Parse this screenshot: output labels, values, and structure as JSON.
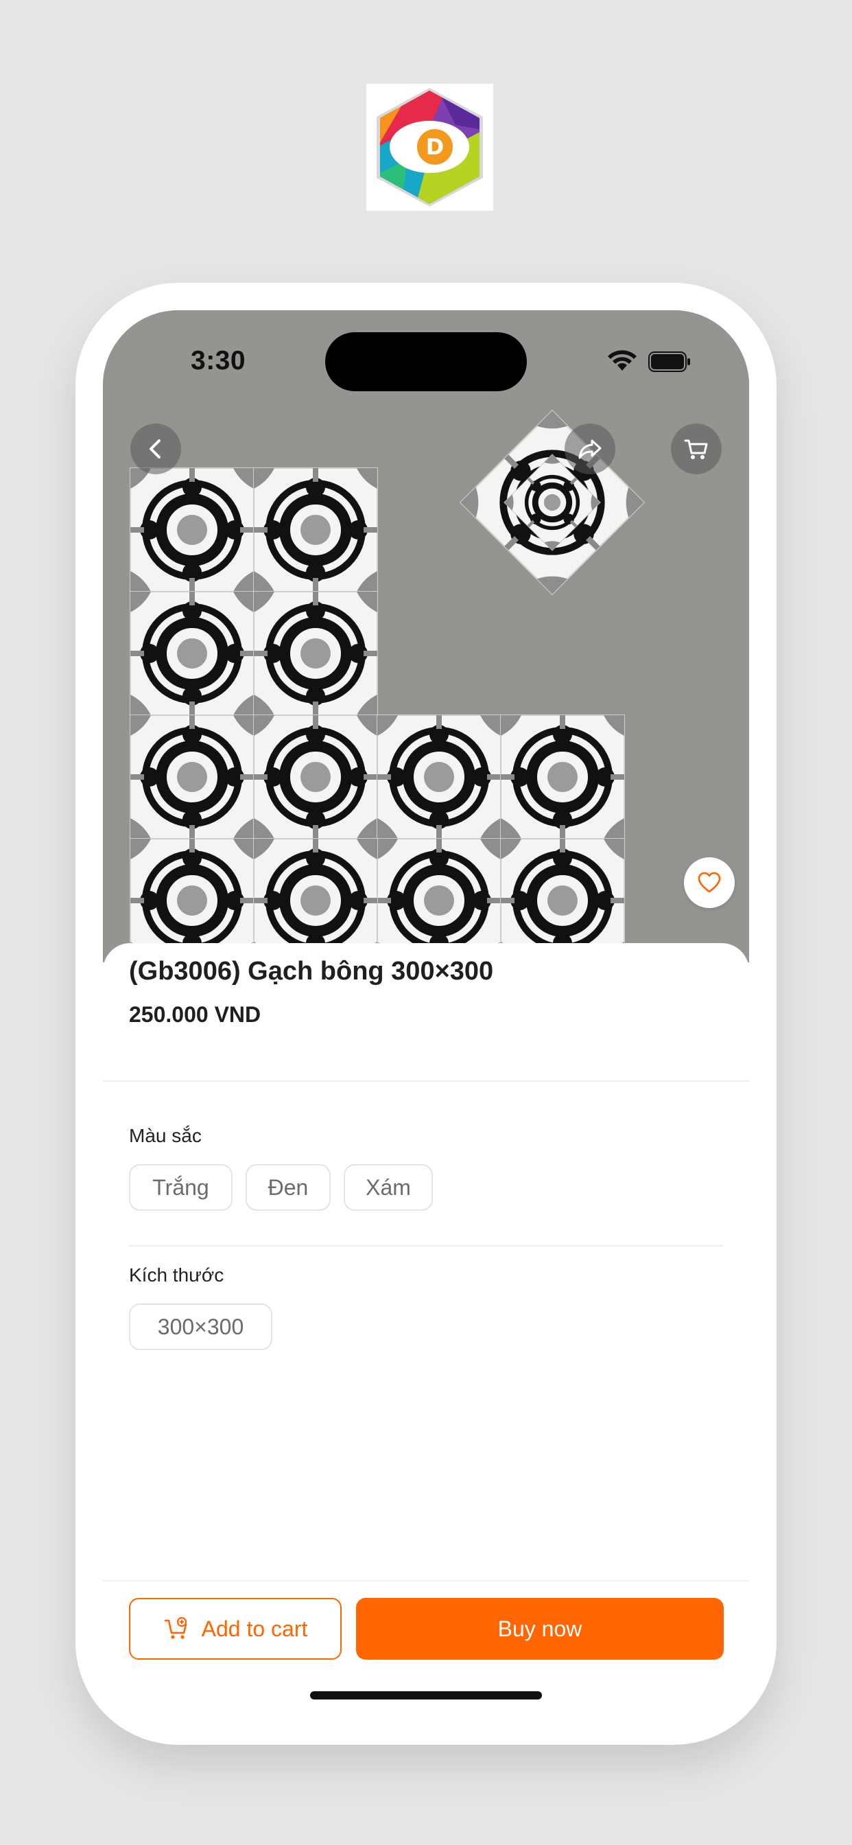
{
  "app": {
    "logo_icon": "app-logo-hexagon",
    "accent_color": "#FF6500"
  },
  "status_bar": {
    "time": "3:30",
    "icons": [
      "wifi-icon",
      "battery-icon"
    ]
  },
  "header_actions": {
    "back_icon": "chevron-left-icon",
    "share_icon": "share-icon",
    "cart_icon": "cart-icon"
  },
  "product": {
    "image_alt": "patterned tiles",
    "title": "(Gb3006) Gạch bông 300×300",
    "price": "250.000 VND",
    "favorite_icon": "heart-icon"
  },
  "options": {
    "color": {
      "label": "Màu sắc",
      "values": [
        "Trắng",
        "Đen",
        "Xám"
      ]
    },
    "size": {
      "label": "Kích thước",
      "values": [
        "300×300"
      ]
    }
  },
  "actions": {
    "add_to_cart": "Add to cart",
    "buy_now": "Buy now"
  }
}
